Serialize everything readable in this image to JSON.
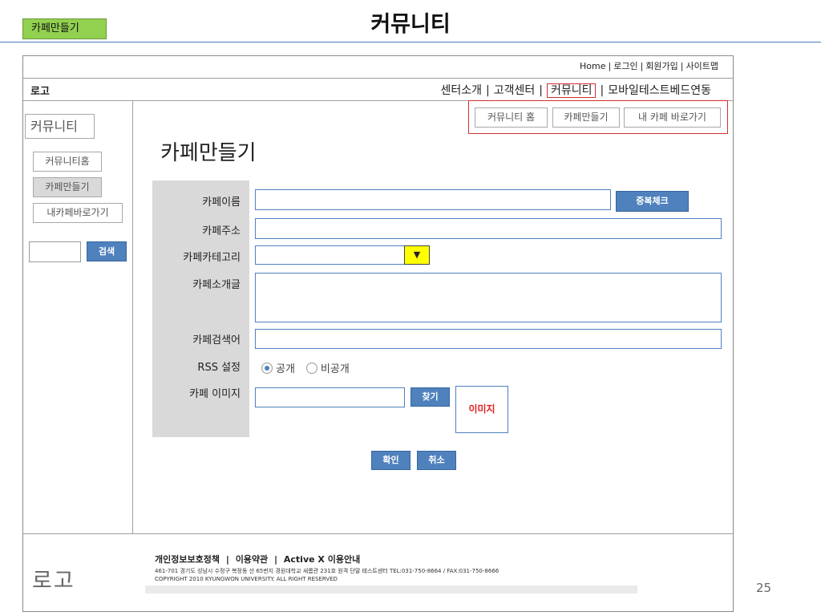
{
  "slide": {
    "tag": "카페만들기",
    "title": "커뮤니티",
    "page_number": "25"
  },
  "util_nav": [
    "Home",
    "로그인",
    "회원가입",
    "사이트맵"
  ],
  "header": {
    "logo": "로고",
    "gnb": [
      "센터소개",
      "고객센터",
      "커뮤니티",
      "모바일테스트베드연동"
    ],
    "gnb_active": "커뮤니티"
  },
  "sidebar": {
    "title": "커뮤니티",
    "items": [
      {
        "label": "커뮤니티홈",
        "active": false
      },
      {
        "label": "카페만들기",
        "active": true
      },
      {
        "label": "내카페바로가기",
        "active": false
      }
    ],
    "search_button": "검색"
  },
  "tabs": [
    "커뮤니티 홈",
    "카페만들기",
    "내 카페 바로가기"
  ],
  "page_title": "카페만들기",
  "form": {
    "labels": {
      "name": "카페이름",
      "address": "카페주소",
      "category": "카페카테고리",
      "intro": "카페소개글",
      "keyword": "카페검색어",
      "rss": "RSS 설정",
      "image": "카페 이미지"
    },
    "dup_check_button": "중복체크",
    "category_arrow": "▼",
    "rss_options": [
      {
        "label": "공개",
        "selected": true
      },
      {
        "label": "비공개",
        "selected": false
      }
    ],
    "find_button": "찾기",
    "image_placeholder": "이미지",
    "confirm_button": "확인",
    "cancel_button": "취소"
  },
  "footer": {
    "logo": "로고",
    "links": [
      "개인정보보호정책",
      "이용약관",
      "Active X 이용안내"
    ],
    "address": "461-701 경기도 성남시 수정구 복정동 산 65번지 경원대학교 새롬관 231호 원격 단말 테스트센터 TEL:031-750-8664 / FAX:031-750-8666",
    "copyright": "COPYRIGHT 2010 KYUNGWON UNIVERSITY. ALL RIGHT RESERVED"
  }
}
